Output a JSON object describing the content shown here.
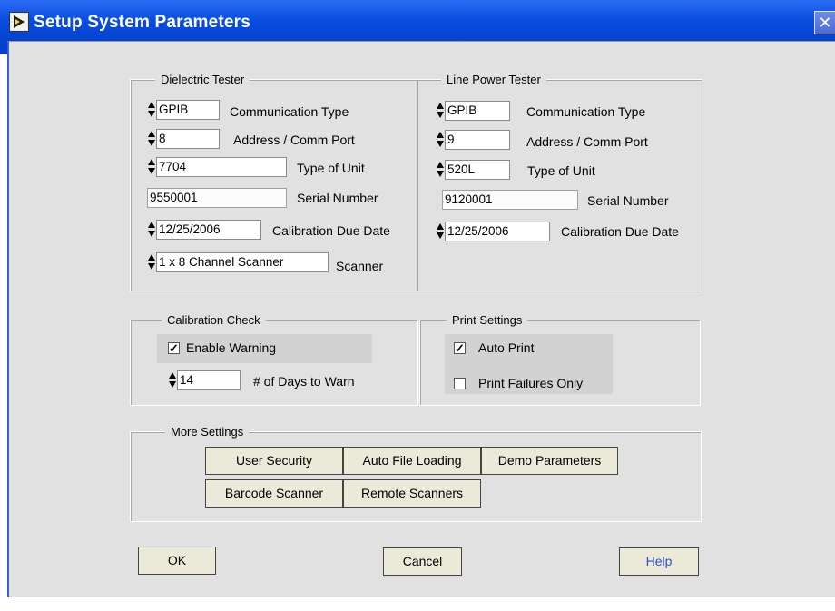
{
  "window": {
    "title": "Setup System Parameters",
    "close_glyph": "✕"
  },
  "dielectric": {
    "legend": "Dielectric Tester",
    "comm_type": {
      "value": "GPIB",
      "label": "Communication Type"
    },
    "address": {
      "value": "8",
      "label": "Address / Comm Port"
    },
    "unit": {
      "value": "7704",
      "label": "Type of Unit"
    },
    "serial": {
      "value": "9550001",
      "label": "Serial Number"
    },
    "calibration": {
      "value": "12/25/2006",
      "label": "Calibration Due Date"
    },
    "scanner": {
      "value": "1 x 8 Channel Scanner",
      "label": "Scanner"
    }
  },
  "line_power": {
    "legend": "Line Power Tester",
    "comm_type": {
      "value": "GPIB",
      "label": "Communication Type"
    },
    "address": {
      "value": "9",
      "label": "Address / Comm Port"
    },
    "unit": {
      "value": "520L",
      "label": "Type of Unit"
    },
    "serial": {
      "value": "9120001",
      "label": "Serial Number"
    },
    "calibration": {
      "value": "12/25/2006",
      "label": "Calibration Due Date"
    }
  },
  "calibration_check": {
    "legend": "Calibration Check",
    "enable_warning": {
      "label": "Enable Warning",
      "checked": true
    },
    "days": {
      "value": "14",
      "label": "# of Days to Warn"
    }
  },
  "print_settings": {
    "legend": "Print Settings",
    "auto_print": {
      "label": "Auto Print",
      "checked": true
    },
    "failures_only": {
      "label": "Print Failures Only",
      "checked": false
    }
  },
  "more_settings": {
    "legend": "More Settings",
    "buttons": [
      "User Security",
      "Auto File Loading",
      "Demo Parameters",
      "Barcode Scanner",
      "Remote Scanners"
    ]
  },
  "footer": {
    "ok": "OK",
    "cancel": "Cancel",
    "help": "Help"
  },
  "colors": {
    "titlebar": "#0a4fe0",
    "panel": "#e1e1e1",
    "button_face": "#ebe9d8",
    "help_text": "#2a4fd0"
  },
  "icons": {
    "app": "labview-run-icon",
    "check": "checkmark-icon",
    "spin": "spin-arrows-icon"
  }
}
